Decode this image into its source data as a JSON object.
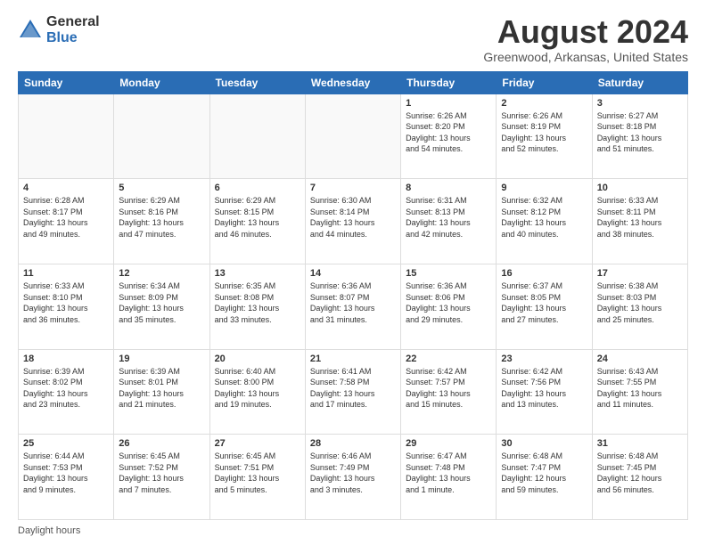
{
  "header": {
    "logo_general": "General",
    "logo_blue": "Blue",
    "month_title": "August 2024",
    "location": "Greenwood, Arkansas, United States"
  },
  "days_of_week": [
    "Sunday",
    "Monday",
    "Tuesday",
    "Wednesday",
    "Thursday",
    "Friday",
    "Saturday"
  ],
  "weeks": [
    [
      {
        "day": "",
        "info": ""
      },
      {
        "day": "",
        "info": ""
      },
      {
        "day": "",
        "info": ""
      },
      {
        "day": "",
        "info": ""
      },
      {
        "day": "1",
        "info": "Sunrise: 6:26 AM\nSunset: 8:20 PM\nDaylight: 13 hours\nand 54 minutes."
      },
      {
        "day": "2",
        "info": "Sunrise: 6:26 AM\nSunset: 8:19 PM\nDaylight: 13 hours\nand 52 minutes."
      },
      {
        "day": "3",
        "info": "Sunrise: 6:27 AM\nSunset: 8:18 PM\nDaylight: 13 hours\nand 51 minutes."
      }
    ],
    [
      {
        "day": "4",
        "info": "Sunrise: 6:28 AM\nSunset: 8:17 PM\nDaylight: 13 hours\nand 49 minutes."
      },
      {
        "day": "5",
        "info": "Sunrise: 6:29 AM\nSunset: 8:16 PM\nDaylight: 13 hours\nand 47 minutes."
      },
      {
        "day": "6",
        "info": "Sunrise: 6:29 AM\nSunset: 8:15 PM\nDaylight: 13 hours\nand 46 minutes."
      },
      {
        "day": "7",
        "info": "Sunrise: 6:30 AM\nSunset: 8:14 PM\nDaylight: 13 hours\nand 44 minutes."
      },
      {
        "day": "8",
        "info": "Sunrise: 6:31 AM\nSunset: 8:13 PM\nDaylight: 13 hours\nand 42 minutes."
      },
      {
        "day": "9",
        "info": "Sunrise: 6:32 AM\nSunset: 8:12 PM\nDaylight: 13 hours\nand 40 minutes."
      },
      {
        "day": "10",
        "info": "Sunrise: 6:33 AM\nSunset: 8:11 PM\nDaylight: 13 hours\nand 38 minutes."
      }
    ],
    [
      {
        "day": "11",
        "info": "Sunrise: 6:33 AM\nSunset: 8:10 PM\nDaylight: 13 hours\nand 36 minutes."
      },
      {
        "day": "12",
        "info": "Sunrise: 6:34 AM\nSunset: 8:09 PM\nDaylight: 13 hours\nand 35 minutes."
      },
      {
        "day": "13",
        "info": "Sunrise: 6:35 AM\nSunset: 8:08 PM\nDaylight: 13 hours\nand 33 minutes."
      },
      {
        "day": "14",
        "info": "Sunrise: 6:36 AM\nSunset: 8:07 PM\nDaylight: 13 hours\nand 31 minutes."
      },
      {
        "day": "15",
        "info": "Sunrise: 6:36 AM\nSunset: 8:06 PM\nDaylight: 13 hours\nand 29 minutes."
      },
      {
        "day": "16",
        "info": "Sunrise: 6:37 AM\nSunset: 8:05 PM\nDaylight: 13 hours\nand 27 minutes."
      },
      {
        "day": "17",
        "info": "Sunrise: 6:38 AM\nSunset: 8:03 PM\nDaylight: 13 hours\nand 25 minutes."
      }
    ],
    [
      {
        "day": "18",
        "info": "Sunrise: 6:39 AM\nSunset: 8:02 PM\nDaylight: 13 hours\nand 23 minutes."
      },
      {
        "day": "19",
        "info": "Sunrise: 6:39 AM\nSunset: 8:01 PM\nDaylight: 13 hours\nand 21 minutes."
      },
      {
        "day": "20",
        "info": "Sunrise: 6:40 AM\nSunset: 8:00 PM\nDaylight: 13 hours\nand 19 minutes."
      },
      {
        "day": "21",
        "info": "Sunrise: 6:41 AM\nSunset: 7:58 PM\nDaylight: 13 hours\nand 17 minutes."
      },
      {
        "day": "22",
        "info": "Sunrise: 6:42 AM\nSunset: 7:57 PM\nDaylight: 13 hours\nand 15 minutes."
      },
      {
        "day": "23",
        "info": "Sunrise: 6:42 AM\nSunset: 7:56 PM\nDaylight: 13 hours\nand 13 minutes."
      },
      {
        "day": "24",
        "info": "Sunrise: 6:43 AM\nSunset: 7:55 PM\nDaylight: 13 hours\nand 11 minutes."
      }
    ],
    [
      {
        "day": "25",
        "info": "Sunrise: 6:44 AM\nSunset: 7:53 PM\nDaylight: 13 hours\nand 9 minutes."
      },
      {
        "day": "26",
        "info": "Sunrise: 6:45 AM\nSunset: 7:52 PM\nDaylight: 13 hours\nand 7 minutes."
      },
      {
        "day": "27",
        "info": "Sunrise: 6:45 AM\nSunset: 7:51 PM\nDaylight: 13 hours\nand 5 minutes."
      },
      {
        "day": "28",
        "info": "Sunrise: 6:46 AM\nSunset: 7:49 PM\nDaylight: 13 hours\nand 3 minutes."
      },
      {
        "day": "29",
        "info": "Sunrise: 6:47 AM\nSunset: 7:48 PM\nDaylight: 13 hours\nand 1 minute."
      },
      {
        "day": "30",
        "info": "Sunrise: 6:48 AM\nSunset: 7:47 PM\nDaylight: 12 hours\nand 59 minutes."
      },
      {
        "day": "31",
        "info": "Sunrise: 6:48 AM\nSunset: 7:45 PM\nDaylight: 12 hours\nand 56 minutes."
      }
    ]
  ],
  "footer": {
    "label": "Daylight hours"
  }
}
